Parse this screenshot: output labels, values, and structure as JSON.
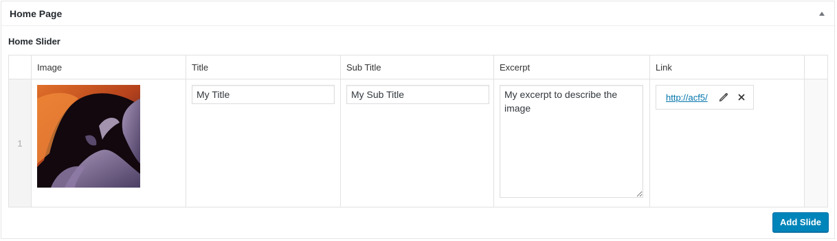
{
  "metabox": {
    "title": "Home Page",
    "toggle_icon": "triangle-up-icon"
  },
  "field": {
    "label": "Home Slider"
  },
  "table": {
    "columns": [
      "Image",
      "Title",
      "Sub Title",
      "Excerpt",
      "Link"
    ],
    "rows": [
      {
        "order": "1",
        "image_desc": "slot-canyon-thumbnail",
        "title": "My Title",
        "sub_title": "My Sub Title",
        "excerpt": "My excerpt to describe the image",
        "link": "http://acf5/"
      }
    ]
  },
  "actions": {
    "add_label": "Add Slide"
  },
  "colors": {
    "accent": "#0085ba",
    "link": "#0073aa"
  }
}
